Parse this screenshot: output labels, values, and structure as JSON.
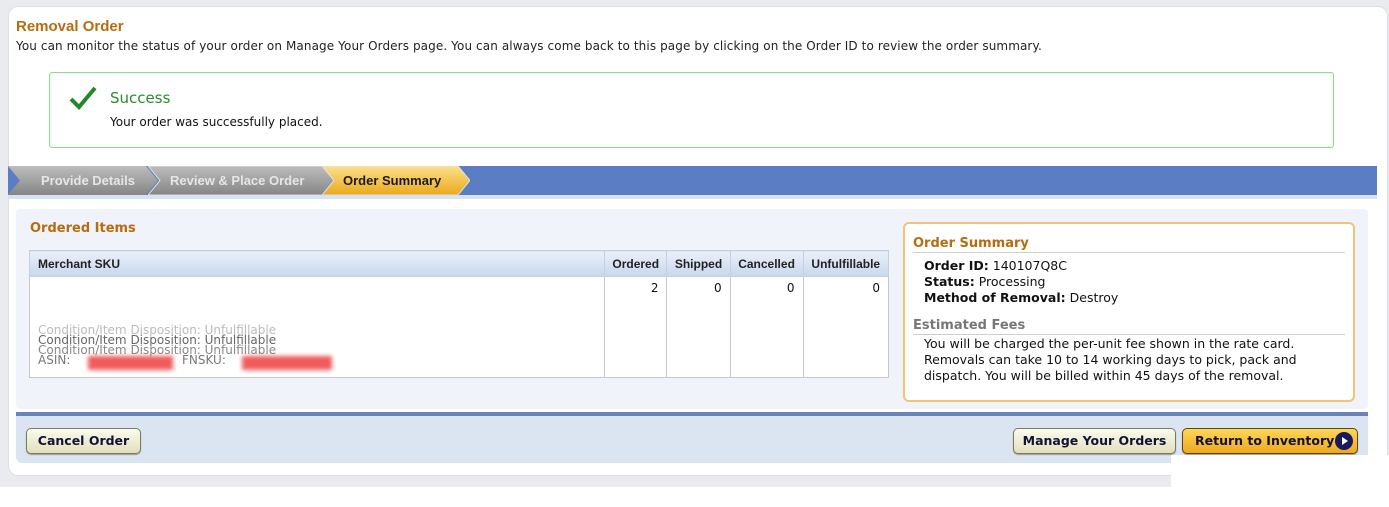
{
  "header": {
    "title": "Removal Order",
    "intro": "You can monitor the status of your order on Manage Your Orders page. You can always come back to this page by clicking on the Order ID to review the order summary."
  },
  "alert": {
    "icon": "checkmark-icon",
    "title": "Success",
    "message": "Your order was successfully placed."
  },
  "steps": [
    {
      "label": "Provide Details",
      "state": "completed"
    },
    {
      "label": "Review & Place Order",
      "state": "completed"
    },
    {
      "label": "Order Summary",
      "state": "current"
    }
  ],
  "ordered_items": {
    "title": "Ordered Items",
    "columns": [
      "Merchant SKU",
      "Ordered",
      "Shipped",
      "Cancelled",
      "Unfulfillable"
    ],
    "rows": [
      {
        "sku_lines": [
          "Condition/Item Disposition: Unfulfillable",
          "Condition/Item Disposition: Unfulfillable",
          "ASIN:",
          "FNSKU:"
        ],
        "ordered": "2",
        "shipped": "0",
        "cancelled": "0",
        "unfulfillable": "0"
      }
    ]
  },
  "summary": {
    "title": "Order Summary",
    "order_id_label": "Order ID:",
    "order_id": "140107Q8C",
    "status_label": "Status:",
    "status": "Processing",
    "method_label": "Method of Removal:",
    "method": "Destroy",
    "fees_title": "Estimated Fees",
    "fees_text": "You will be charged the per-unit fee shown in the rate card. Removals can take 10 to 14 working days to pick, pack and dispatch. You will be billed within 45 days of the removal."
  },
  "actions": {
    "cancel": "Cancel Order",
    "manage": "Manage Your Orders",
    "return": "Return to Inventory"
  },
  "colors": {
    "accent_title": "#b56d0e",
    "success": "#2a8a2a",
    "progress_bar": "#5b7dc3",
    "step_current": "#f5bc2f"
  }
}
